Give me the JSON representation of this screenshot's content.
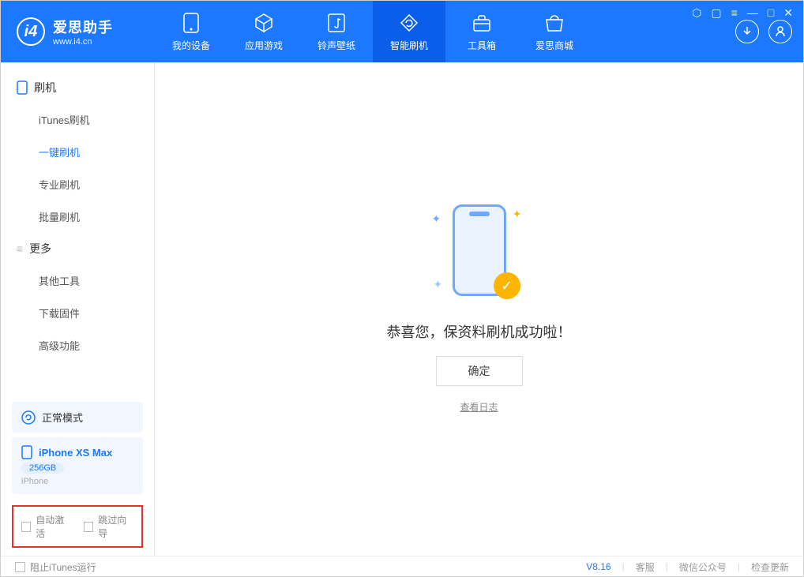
{
  "app": {
    "title": "爱思助手",
    "subtitle": "www.i4.cn"
  },
  "nav": {
    "items": [
      {
        "label": "我的设备"
      },
      {
        "label": "应用游戏"
      },
      {
        "label": "铃声壁纸"
      },
      {
        "label": "智能刷机"
      },
      {
        "label": "工具箱"
      },
      {
        "label": "爱思商城"
      }
    ]
  },
  "sidebar": {
    "section1_title": "刷机",
    "section1_items": [
      "iTunes刷机",
      "一键刷机",
      "专业刷机",
      "批量刷机"
    ],
    "section2_title": "更多",
    "section2_items": [
      "其他工具",
      "下载固件",
      "高级功能"
    ],
    "mode_label": "正常模式",
    "device": {
      "name": "iPhone XS Max",
      "storage": "256GB",
      "type": "iPhone"
    },
    "opt1": "自动激活",
    "opt2": "跳过向导"
  },
  "main": {
    "message": "恭喜您，保资料刷机成功啦！",
    "ok": "确定",
    "view_log": "查看日志"
  },
  "footer": {
    "block_itunes": "阻止iTunes运行",
    "version": "V8.16",
    "service": "客服",
    "wechat": "微信公众号",
    "update": "检查更新"
  }
}
